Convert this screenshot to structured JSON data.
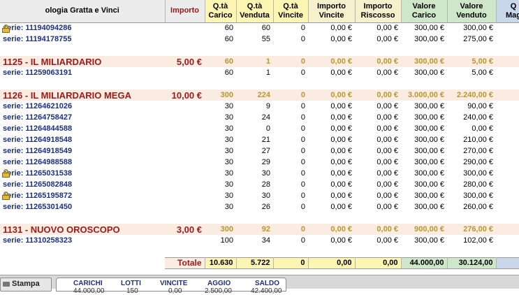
{
  "columns": {
    "tipologia": "ologia Gratta e Vinci",
    "importo": "Importo",
    "qta_carico": [
      "Q.tà",
      "Carico"
    ],
    "qta_venduta": [
      "Q.tà",
      "Venduta"
    ],
    "qta_vincite": [
      "Q.tà",
      "Vincite"
    ],
    "importo_vincite": [
      "Importo",
      "Vincite"
    ],
    "importo_riscosso": [
      "Importo",
      "Riscosso"
    ],
    "valore_carico": [
      "Valore",
      "Carico"
    ],
    "valore_venduto": [
      "Valore",
      "Venduto"
    ],
    "mag": [
      "Q",
      "Mag"
    ]
  },
  "rows": [
    {
      "type": "serie",
      "label": "serie: 11194094286",
      "lock": true,
      "carico": "60",
      "venduta": "60",
      "vincite": "0",
      "imp_vincite": "0,00 €",
      "imp_riscosso": "0,00 €",
      "val_carico": "300,00 €",
      "val_venduto": "300,00 €"
    },
    {
      "type": "serie",
      "label": "serie: 11194178755",
      "lock": false,
      "carico": "60",
      "venduta": "55",
      "vincite": "0",
      "imp_vincite": "0,00 €",
      "imp_riscosso": "0,00 €",
      "val_carico": "300,00 €",
      "val_venduto": "275,00 €"
    },
    {
      "type": "spacer"
    },
    {
      "type": "group",
      "label": "1125 - IL MILIARDARIO",
      "importo": "5,00 €",
      "carico": "60",
      "venduta": "1",
      "vincite": "0",
      "imp_vincite": "0,00 €",
      "imp_riscosso": "0,00 €",
      "val_carico": "300,00 €",
      "val_venduto": "5,00 €"
    },
    {
      "type": "serie",
      "label": "serie: 11259063191",
      "lock": false,
      "carico": "60",
      "venduta": "1",
      "vincite": "0",
      "imp_vincite": "0,00 €",
      "imp_riscosso": "0,00 €",
      "val_carico": "300,00 €",
      "val_venduto": "5,00 €"
    },
    {
      "type": "spacer"
    },
    {
      "type": "group",
      "label": "1126 - IL MILIARDARIO MEGA",
      "importo": "10,00 €",
      "carico": "300",
      "venduta": "224",
      "vincite": "0",
      "imp_vincite": "0,00 €",
      "imp_riscosso": "0,00 €",
      "val_carico": "3.000,00 €",
      "val_venduto": "2.240,00 €"
    },
    {
      "type": "serie",
      "label": "serie: 11264621026",
      "lock": false,
      "carico": "30",
      "venduta": "9",
      "vincite": "0",
      "imp_vincite": "0,00 €",
      "imp_riscosso": "0,00 €",
      "val_carico": "300,00 €",
      "val_venduto": "90,00 €"
    },
    {
      "type": "serie",
      "label": "serie: 11264758427",
      "lock": false,
      "carico": "30",
      "venduta": "24",
      "vincite": "0",
      "imp_vincite": "0,00 €",
      "imp_riscosso": "0,00 €",
      "val_carico": "300,00 €",
      "val_venduto": "240,00 €"
    },
    {
      "type": "serie",
      "label": "serie: 11264844588",
      "lock": false,
      "carico": "30",
      "venduta": "0",
      "vincite": "0",
      "imp_vincite": "0,00 €",
      "imp_riscosso": "0,00 €",
      "val_carico": "300,00 €",
      "val_venduto": "0,00 €"
    },
    {
      "type": "serie",
      "label": "serie: 11264918548",
      "lock": false,
      "carico": "30",
      "venduta": "21",
      "vincite": "0",
      "imp_vincite": "0,00 €",
      "imp_riscosso": "0,00 €",
      "val_carico": "300,00 €",
      "val_venduto": "210,00 €"
    },
    {
      "type": "serie",
      "label": "serie: 11264918549",
      "lock": false,
      "carico": "30",
      "venduta": "27",
      "vincite": "0",
      "imp_vincite": "0,00 €",
      "imp_riscosso": "0,00 €",
      "val_carico": "300,00 €",
      "val_venduto": "270,00 €"
    },
    {
      "type": "serie",
      "label": "serie: 11264988588",
      "lock": false,
      "carico": "30",
      "venduta": "29",
      "vincite": "0",
      "imp_vincite": "0,00 €",
      "imp_riscosso": "0,00 €",
      "val_carico": "300,00 €",
      "val_venduto": "290,00 €"
    },
    {
      "type": "serie",
      "label": "serie: 11265031538",
      "lock": true,
      "carico": "30",
      "venduta": "30",
      "vincite": "0",
      "imp_vincite": "0,00 €",
      "imp_riscosso": "0,00 €",
      "val_carico": "300,00 €",
      "val_venduto": "300,00 €"
    },
    {
      "type": "serie",
      "label": "serie: 11265082848",
      "lock": false,
      "carico": "30",
      "venduta": "28",
      "vincite": "0",
      "imp_vincite": "0,00 €",
      "imp_riscosso": "0,00 €",
      "val_carico": "300,00 €",
      "val_venduto": "280,00 €"
    },
    {
      "type": "serie",
      "label": "serie: 11265195872",
      "lock": true,
      "carico": "30",
      "venduta": "30",
      "vincite": "0",
      "imp_vincite": "0,00 €",
      "imp_riscosso": "0,00 €",
      "val_carico": "300,00 €",
      "val_venduto": "300,00 €"
    },
    {
      "type": "serie",
      "label": "serie: 11265301450",
      "lock": false,
      "carico": "30",
      "venduta": "26",
      "vincite": "0",
      "imp_vincite": "0,00 €",
      "imp_riscosso": "0,00 €",
      "val_carico": "300,00 €",
      "val_venduto": "260,00 €"
    },
    {
      "type": "spacer"
    },
    {
      "type": "group",
      "label": "1131 - NUOVO OROSCOPO",
      "importo": "3,00 €",
      "carico": "300",
      "venduta": "92",
      "vincite": "0",
      "imp_vincite": "0,00 €",
      "imp_riscosso": "0,00 €",
      "val_carico": "900,00 €",
      "val_venduto": "276,00 €"
    },
    {
      "type": "serie",
      "label": "serie: 11310258323",
      "lock": false,
      "carico": "100",
      "venduta": "34",
      "vincite": "0",
      "imp_vincite": "0,00 €",
      "imp_riscosso": "0,00 €",
      "val_carico": "300,00 €",
      "val_venduto": "102,00 €"
    },
    {
      "type": "spacer"
    }
  ],
  "totals": {
    "label": "Totale",
    "carico": "10.630",
    "venduta": "5.722",
    "vincite": "0",
    "imp_vincite": "0,00",
    "imp_riscosso": "0,00",
    "val_carico": "44.000,00",
    "val_venduto": "30.124,00"
  },
  "footer": {
    "print_label": "Stampa",
    "summary_labels": [
      "CARICHI",
      "LOTTI",
      "VINCITE",
      "AGGIO",
      "SALDO"
    ],
    "summary_values": [
      "44.000,00",
      "150",
      "0,00",
      "2.500,00",
      "42.400,00"
    ]
  }
}
